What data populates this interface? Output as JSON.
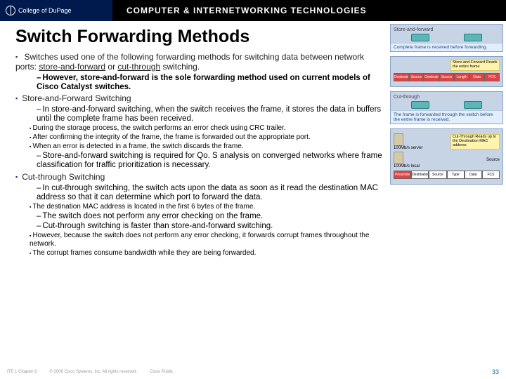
{
  "header": {
    "college": "College of DuPage",
    "course": "COMPUTER & INTERNETWORKING TECHNOLOGIES"
  },
  "title": "Switch Forwarding Methods",
  "bullet1": {
    "text_a": "Switches used one of the following forwarding methods for switching data between network ports: ",
    "link1": "store-and-forward",
    "text_b": " or ",
    "link2": "cut-through",
    "text_c": " switching.",
    "sub1": "However, store-and-forward is the sole forwarding method used on current models of Cisco Catalyst switches."
  },
  "saf": {
    "title": "Store-and-Forward Switching",
    "p1": "In store-and-forward switching, when the switch receives the frame, it stores the data in buffers until the complete frame has been received.",
    "d1": "During the storage process, the switch performs an error check using CRC trailer.",
    "d2": "After confirming the integrity of the frame, the frame is forwarded out the appropriate port.",
    "d3": "When an error is detected in a frame, the switch discards the frame.",
    "p2": "Store-and-forward switching is required for Qo. S analysis on converged networks where frame classification for traffic prioritization is necessary."
  },
  "cut": {
    "title": "Cut-through Switching",
    "p1": "In cut-through switching, the switch acts upon the data as soon as it read the destination MAC address so that it can determine which port to forward the data.",
    "d1": "The destination MAC address is located in the first 6 bytes of the frame.",
    "p2": "The switch does not perform any error checking on the frame.",
    "p3": "Cut-through switching is faster than store-and-forward switching.",
    "d2": "However, because the switch does not perform any error checking, it forwards corrupt frames throughout the network.",
    "d3": "The corrupt frames consume bandwidth while they are being forwarded."
  },
  "diagram": {
    "saf_label": "Store-and-forward",
    "saf_caption": "Complete frame is received before forwarding.",
    "saf_read": "Store-and-Forward Reads the entire frame",
    "fields": {
      "dest": "Destination",
      "src": "Source",
      "type": "Type",
      "data": "Data",
      "fcs": "FCS",
      "len": "Length",
      "pre": "Preamble"
    },
    "cut_label": "Cut-through",
    "cut_caption": "The frame is forwarded through the switch before the entire frame is received.",
    "cut_read": "Cut-Through Reads up to the Destination MAC address",
    "svr1": "100Mb/s server",
    "svr2": "100Mb/s local",
    "source": "Source"
  },
  "footer": {
    "chapter": "ITE 1 Chapter 6",
    "copyright": "© 2006 Cisco Systems, Inc. All rights reserved.",
    "public": "Cisco Public",
    "page": "33"
  }
}
